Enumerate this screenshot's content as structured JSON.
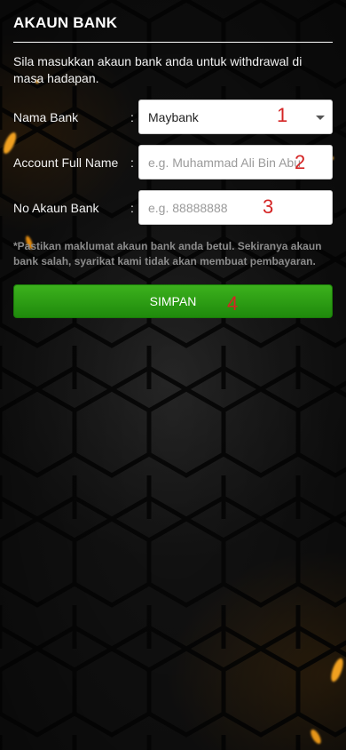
{
  "page": {
    "title": "AKAUN BANK",
    "intro": "Sila masukkan akaun bank anda untuk withdrawal di masa hadapan."
  },
  "form": {
    "colon": ":",
    "bank_name": {
      "label": "Nama Bank",
      "value": "Maybank",
      "annotation": "1"
    },
    "full_name": {
      "label": "Account Full Name",
      "placeholder": "e.g. Muhammad Ali Bin Abu",
      "value": "",
      "annotation": "2"
    },
    "account_no": {
      "label": "No Akaun Bank",
      "placeholder": "e.g. 88888888",
      "value": "",
      "annotation": "3"
    }
  },
  "note": "*Pastikan maklumat akaun bank anda betul. Sekiranya akaun bank salah, syarikat kami tidak akan membuat pembayaran.",
  "button": {
    "label": "SIMPAN",
    "annotation": "4"
  },
  "colors": {
    "background": "#141414",
    "button_green": "#2a9d14",
    "annotation_red": "#d42424",
    "note_gray": "#8c8c8c"
  }
}
